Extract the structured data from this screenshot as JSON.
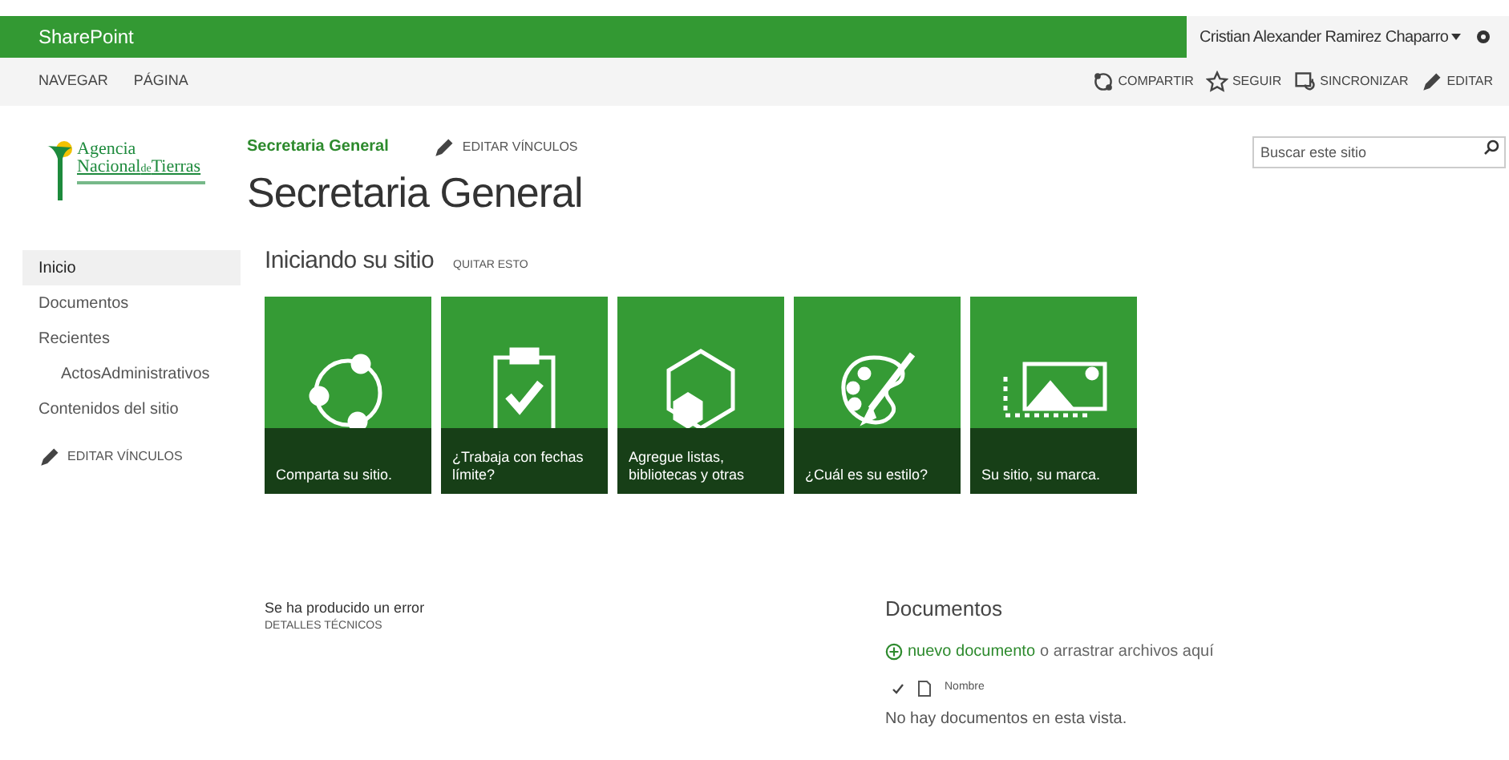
{
  "suite_bar": {
    "brand": "SharePoint",
    "user": "Cristian Alexander Ramirez Chaparro"
  },
  "ribbon": {
    "tabs": [
      "NAVEGAR",
      "PÁGINA"
    ],
    "actions": [
      {
        "kind": "share",
        "label": "COMPARTIR"
      },
      {
        "kind": "follow",
        "label": "SEGUIR"
      },
      {
        "kind": "sync",
        "label": "SINCRONIZAR"
      },
      {
        "kind": "edit",
        "label": "EDITAR"
      }
    ]
  },
  "logo": {
    "line_1": "Agencia",
    "line_2": "Nacional",
    "line_2_small": "de",
    "line_3": "Tierras"
  },
  "header": {
    "breadcrumb": "Secretaria General",
    "edit_links": "EDITAR VÍNCULOS",
    "title": "Secretaria General",
    "search": {
      "placeholder": "Buscar este sitio"
    }
  },
  "sidebar": {
    "items": [
      {
        "label": "Inicio",
        "selected": true
      },
      {
        "label": "Documentos",
        "selected": false
      },
      {
        "label": "Recientes",
        "selected": false,
        "children": [
          {
            "label": "ActosAdministrativos",
            "selected": false
          }
        ]
      },
      {
        "label": "Contenidos del sitio",
        "selected": false
      }
    ],
    "edit_links": "EDITAR VÍNCULOS"
  },
  "getting_started": {
    "title": "Iniciando su sitio",
    "dismiss": "QUITAR ESTO",
    "tiles": [
      {
        "kind": "share",
        "label": "Comparta su sitio."
      },
      {
        "kind": "task",
        "label": "¿Trabaja con fechas límite?"
      },
      {
        "kind": "apps",
        "label": "Agregue listas, bibliotecas y otras"
      },
      {
        "kind": "palette",
        "label": "¿Cuál es su estilo?"
      },
      {
        "kind": "brand",
        "label": "Su sitio, su marca."
      }
    ]
  },
  "error": {
    "message": "Se ha producido un error",
    "details": "DETALLES TÉCNICOS"
  },
  "documents": {
    "title": "Documentos",
    "new_link": "nuevo documento",
    "drag_hint": "o arrastrar archivos aquí",
    "column": "Nombre",
    "empty": "No hay documentos en esta vista."
  }
}
